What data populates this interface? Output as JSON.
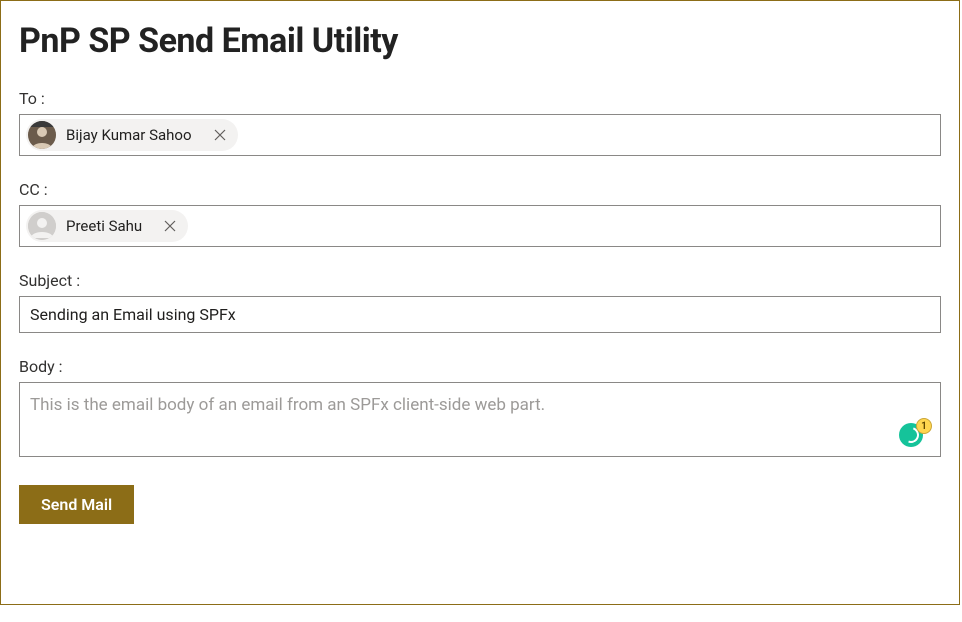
{
  "header": {
    "title": "PnP SP Send Email Utility"
  },
  "fields": {
    "to": {
      "label": "To :",
      "chip": {
        "name": "Bijay Kumar Sahoo"
      }
    },
    "cc": {
      "label": "CC :",
      "chip": {
        "name": "Preeti Sahu"
      }
    },
    "subject": {
      "label": "Subject :",
      "value": "Sending an Email using SPFx"
    },
    "body": {
      "label": "Body :",
      "value": "This is the email body of an email from an SPFx client-side web part."
    }
  },
  "grammarly": {
    "badge": "1"
  },
  "actions": {
    "send_label": "Send Mail"
  }
}
